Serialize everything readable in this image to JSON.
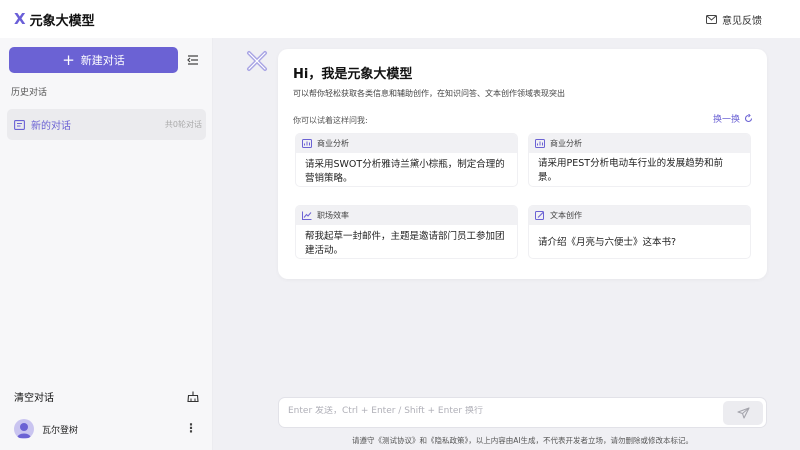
{
  "header": {
    "logo_mark": "X",
    "logo_text": "元象大模型",
    "feedback": "意见反馈"
  },
  "sidebar": {
    "new_chat": "新建对话",
    "history_label": "历史对话",
    "conversation": {
      "title": "新的对话",
      "count": "共0轮对话"
    },
    "clear": "清空对话",
    "user_name": "瓦尔登树"
  },
  "welcome": {
    "title": "Hi，我是元象大模型",
    "subtitle": "可以帮你轻松获取各类信息和辅助创作，在知识问答、文本创作领域表现突出",
    "hint": "你可以试着这样问我:",
    "refresh": "换一换",
    "cards": [
      {
        "category": "商业分析",
        "icon": "chart-icon",
        "text": "请采用SWOT分析雅诗兰黛小棕瓶，制定合理的营销策略。"
      },
      {
        "category": "商业分析",
        "icon": "chart-icon",
        "text": "请采用PEST分析电动车行业的发展趋势和前景。"
      },
      {
        "category": "职场效率",
        "icon": "trend-icon",
        "text": "帮我起草一封邮件，主题是邀请部门员工参加团建活动。"
      },
      {
        "category": "文本创作",
        "icon": "edit-icon",
        "text": "请介绍《月亮与六便士》这本书?"
      }
    ]
  },
  "input": {
    "placeholder": "Enter 发送，Ctrl + Enter / Shift + Enter 换行"
  },
  "disclaimer": "请遵守《测试协议》和《隐私政策》，以上内容由AI生成，不代表开发者立场，请勿删除或修改本标记。",
  "colors": {
    "accent": "#6b62d4",
    "background": "#f0f0f4",
    "card_head": "#f1f1f4"
  }
}
